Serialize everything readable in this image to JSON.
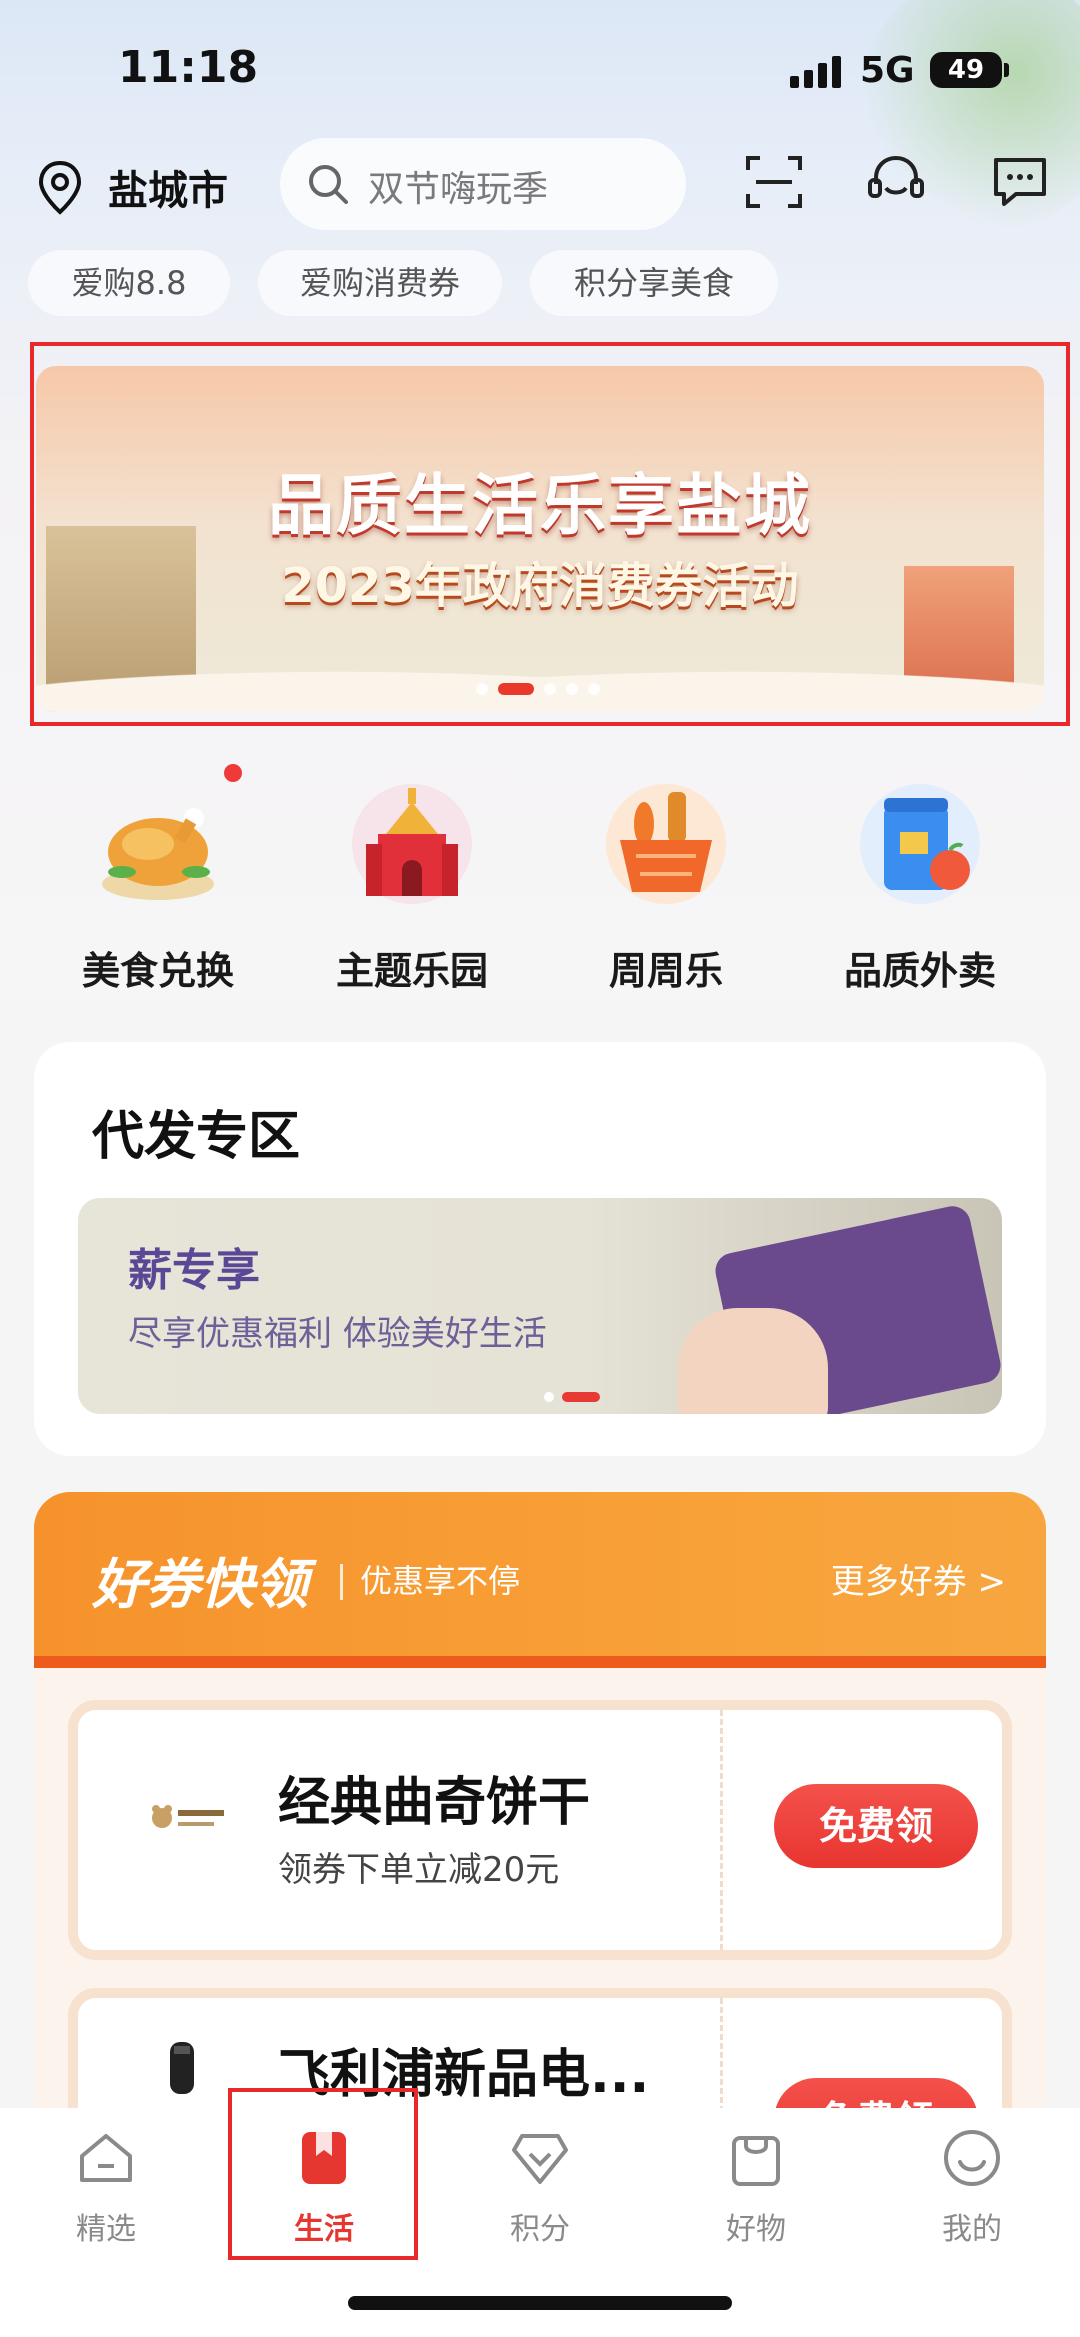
{
  "status_bar": {
    "time": "11:18",
    "network": "5G",
    "battery": "49"
  },
  "header": {
    "city": "盐城市",
    "search_placeholder": "双节嗨玩季",
    "chips": [
      "爱购8.8",
      "爱购消费券",
      "积分享美食"
    ]
  },
  "banner": {
    "title": "品质生活乐享盐城",
    "subtitle": "2023年政府消费券活动",
    "dot_count": 5,
    "active_index": 1
  },
  "quick_entries": [
    {
      "label": "美食兑换",
      "icon": "roast-chicken-icon",
      "color": "#f5a623",
      "badge": true
    },
    {
      "label": "主题乐园",
      "icon": "castle-icon",
      "color": "#e7303a",
      "badge": false
    },
    {
      "label": "周周乐",
      "icon": "grocery-basket-icon",
      "color": "#f08a2a",
      "badge": false
    },
    {
      "label": "品质外卖",
      "icon": "delivery-bag-icon",
      "color": "#3a8ef0",
      "badge": false
    }
  ],
  "daifa": {
    "title": "代发专区",
    "promo_title": "薪专享",
    "promo_subtitle": "尽享优惠福利 体验美好生活"
  },
  "coupons": {
    "brand": "好券快领",
    "tagline": "优惠享不停",
    "more_label": "更多好券 >",
    "items": [
      {
        "title": "经典曲奇饼干",
        "subtitle": "领券下单立减20元",
        "button": "免费领",
        "logo": "bear-cookie-logo"
      },
      {
        "title": "飞利浦新品电...",
        "subtitle": "",
        "button": "免费领",
        "logo": "shaver-logo"
      }
    ]
  },
  "tabbar": {
    "tabs": [
      {
        "label": "精选",
        "icon": "home-icon"
      },
      {
        "label": "生活",
        "icon": "bookmark-icon"
      },
      {
        "label": "积分",
        "icon": "diamond-icon"
      },
      {
        "label": "好物",
        "icon": "shopping-bag-icon"
      },
      {
        "label": "我的",
        "icon": "smiley-face-icon"
      }
    ],
    "active_index": 1
  },
  "colors": {
    "accent": "#e5362f",
    "coupon_orange": "#f6922c",
    "highlight_frame": "#e8292c"
  }
}
